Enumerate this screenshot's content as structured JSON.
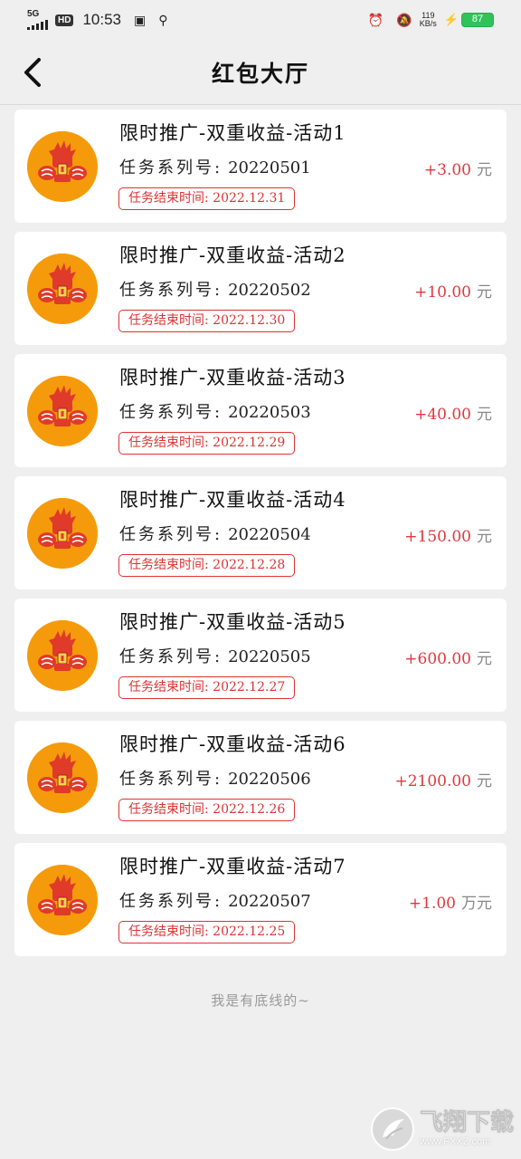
{
  "status_bar": {
    "network": "5G",
    "hd": "HD",
    "time": "10:53",
    "speed_value": "119",
    "speed_unit": "KB/s",
    "battery": "87"
  },
  "header": {
    "title": "红包大厅"
  },
  "cards": [
    {
      "title": "限时推广-双重收益-活动1",
      "series_label": "任务系列号:",
      "series_no": "20220501",
      "deadline": "任务结束时间: 2022.12.31",
      "amount": "+3.00",
      "unit": "元"
    },
    {
      "title": "限时推广-双重收益-活动2",
      "series_label": "任务系列号:",
      "series_no": "20220502",
      "deadline": "任务结束时间: 2022.12.30",
      "amount": "+10.00",
      "unit": "元"
    },
    {
      "title": "限时推广-双重收益-活动3",
      "series_label": "任务系列号:",
      "series_no": "20220503",
      "deadline": "任务结束时间: 2022.12.29",
      "amount": "+40.00",
      "unit": "元"
    },
    {
      "title": "限时推广-双重收益-活动4",
      "series_label": "任务系列号:",
      "series_no": "20220504",
      "deadline": "任务结束时间: 2022.12.28",
      "amount": "+150.00",
      "unit": "元"
    },
    {
      "title": "限时推广-双重收益-活动5",
      "series_label": "任务系列号:",
      "series_no": "20220505",
      "deadline": "任务结束时间: 2022.12.27",
      "amount": "+600.00",
      "unit": "元"
    },
    {
      "title": "限时推广-双重收益-活动6",
      "series_label": "任务系列号:",
      "series_no": "20220506",
      "deadline": "任务结束时间: 2022.12.26",
      "amount": "+2100.00",
      "unit": "元"
    },
    {
      "title": "限时推广-双重收益-活动7",
      "series_label": "任务系列号:",
      "series_no": "20220507",
      "deadline": "任务结束时间: 2022.12.25",
      "amount": "+1.00",
      "unit": "万元"
    }
  ],
  "footer_note": "我是有底线的~",
  "watermark": {
    "big": "飞翔下载",
    "small": "www.FXXZ.com"
  },
  "colors": {
    "amount": "#e0383e",
    "deadline_border": "#dd3333",
    "avatar_bg": "#f59b0b",
    "battery": "#2fc35a"
  },
  "icons": {
    "back": "chevron-left-icon",
    "avatar": "red-envelope-avatar-icon"
  }
}
